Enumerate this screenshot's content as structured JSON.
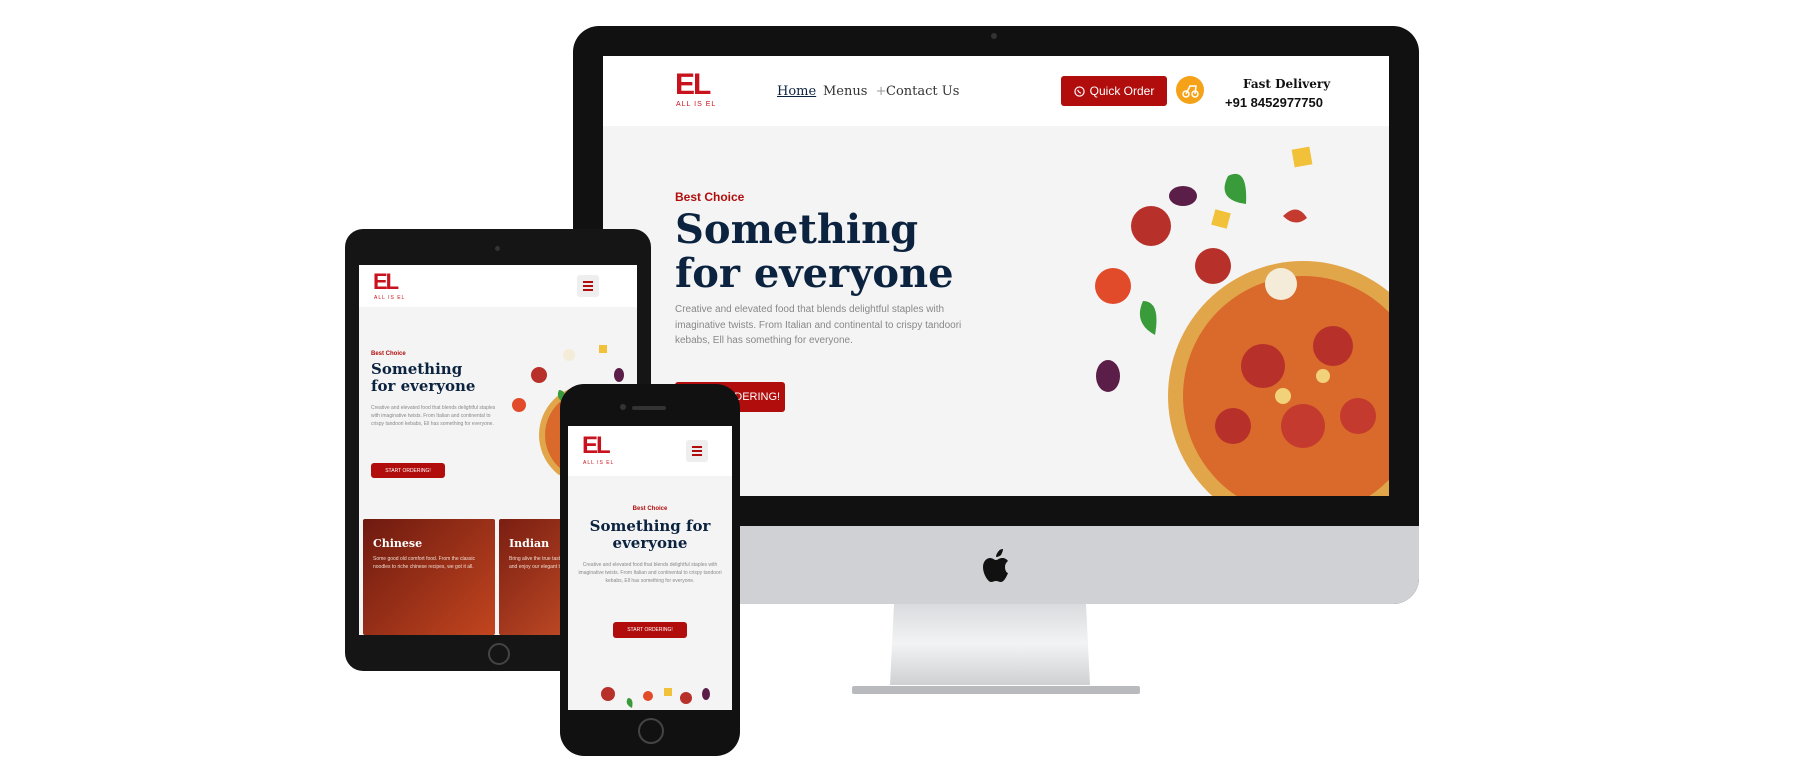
{
  "brand": {
    "logo_text": "EL",
    "logo_sub": "ALL IS EL"
  },
  "nav": {
    "links": [
      "Home",
      "Menus",
      "Contact Us"
    ],
    "menus_plus": "+",
    "quick_order": "Quick Order",
    "delivery_label": "Fast Delivery",
    "delivery_phone": "+91 8452977750"
  },
  "hero": {
    "eyebrow": "Best Choice",
    "title": "Something for everyone",
    "description": "Creative and elevated food that blends delightful staples with imaginative twists. From Italian and continental to crispy tandoori kebabs, Ell has something for everyone.",
    "cta": "START ORDERING!"
  },
  "tablet": {
    "cards": [
      {
        "title": "Chinese",
        "text": "Some good old comfort food. From the classic noodles to riche chinese recipes, we got it all."
      },
      {
        "title": "Indian",
        "text": "Bring alive the true tastes of the Indian cuisine and enjoy our elegant tandoori."
      }
    ]
  },
  "colors": {
    "accent": "#b10d0d",
    "navy": "#0c2340",
    "logo_red": "#c8121d",
    "delivery_orange": "#f6a218"
  }
}
